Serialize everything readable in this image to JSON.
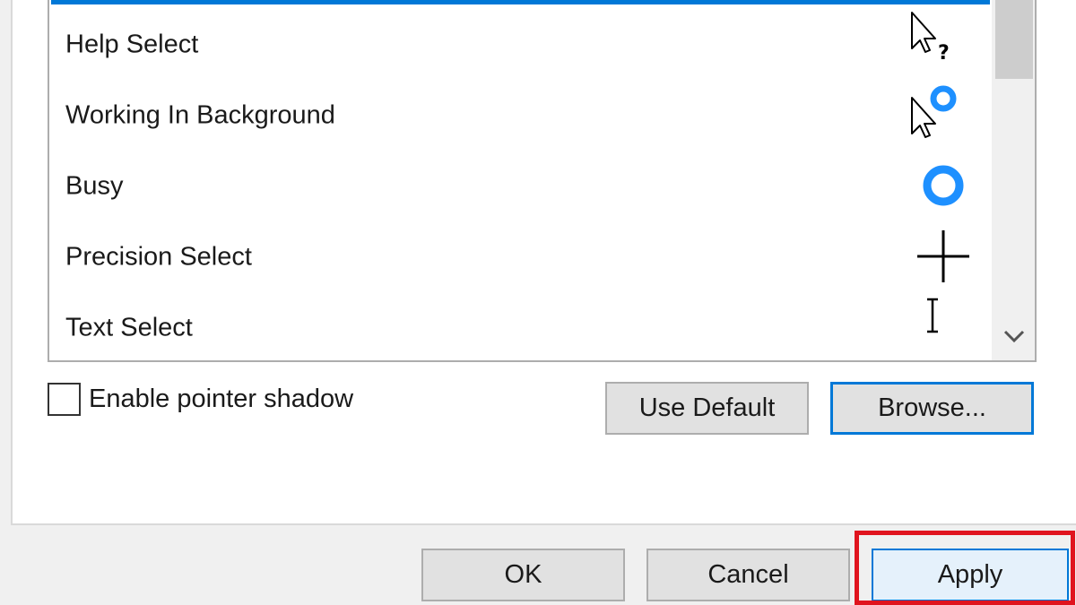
{
  "pointer_list": {
    "items": [
      {
        "label": "Help Select",
        "icon": "help-select-cursor-icon"
      },
      {
        "label": "Working In Background",
        "icon": "working-in-background-cursor-icon"
      },
      {
        "label": "Busy",
        "icon": "busy-cursor-icon"
      },
      {
        "label": "Precision Select",
        "icon": "precision-select-cursor-icon"
      },
      {
        "label": "Text Select",
        "icon": "text-select-cursor-icon"
      }
    ]
  },
  "options": {
    "pointer_shadow_label": "Enable pointer shadow",
    "pointer_shadow_checked": false
  },
  "actions": {
    "use_default": "Use Default",
    "browse": "Browse..."
  },
  "dialog_buttons": {
    "ok": "OK",
    "cancel": "Cancel",
    "apply": "Apply"
  },
  "colors": {
    "accent": "#0078d7",
    "busy_ring": "#1e90ff",
    "annotation_red": "#e0141e"
  }
}
